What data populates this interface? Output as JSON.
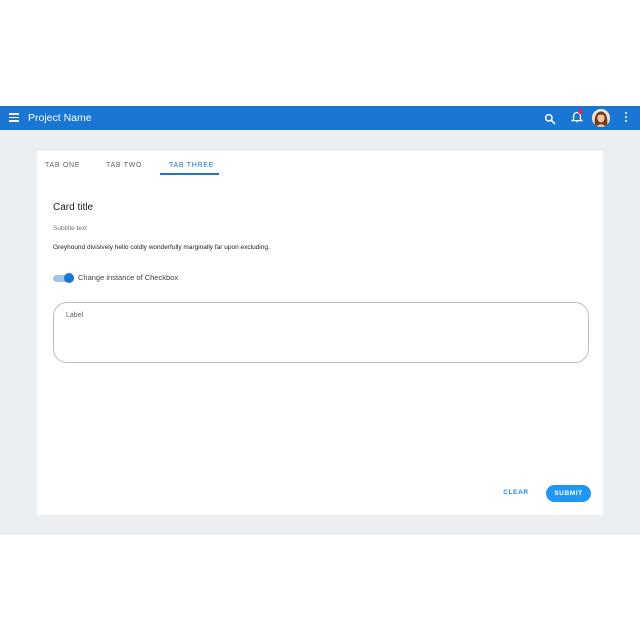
{
  "appbar": {
    "title": "Project Name",
    "colors": {
      "background": "#1976d2",
      "notification_dot": "#e91e63"
    },
    "icons": [
      "menu-icon",
      "search-icon",
      "bell-icon",
      "avatar",
      "more-vert-icon"
    ]
  },
  "tabs": [
    {
      "label": "TAB ONE",
      "active": false
    },
    {
      "label": "TAB TWO",
      "active": false
    },
    {
      "label": "TAB THREE",
      "active": true
    }
  ],
  "card": {
    "title": "Card title",
    "subtitle": "Subtitle text",
    "body": "Greyhound divisively hello coldly wonderfully marginally far upon excluding."
  },
  "switch": {
    "label": "Change instance of Checkbox",
    "checked": true
  },
  "textfield": {
    "label": "Label",
    "value": ""
  },
  "actions": {
    "clear_label": "CLEAR",
    "submit_label": "SUBMIT"
  },
  "colors": {
    "primary": "#1976d2",
    "page_background": "#eceff2",
    "button": "#2196f3"
  }
}
